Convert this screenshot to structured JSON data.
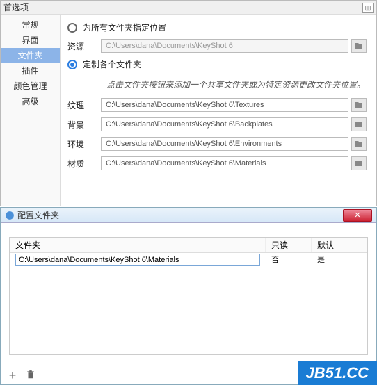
{
  "topWindow": {
    "title": "首选项",
    "sidebar": {
      "items": [
        {
          "label": "常规"
        },
        {
          "label": "界面"
        },
        {
          "label": "文件夹"
        },
        {
          "label": "插件"
        },
        {
          "label": "颜色管理"
        },
        {
          "label": "高级"
        }
      ],
      "selectedIndex": 2
    },
    "content": {
      "radio1_label": "为所有文件夹指定位置",
      "resource_label": "资源",
      "resource_path": "C:\\Users\\dana\\Documents\\KeyShot 6",
      "radio2_label": "定制各个文件夹",
      "hint": "点击文件夹按钮来添加一个共享文件夹或为特定资源更改文件夹位置。",
      "rows": [
        {
          "label": "纹理",
          "path": "C:\\Users\\dana\\Documents\\KeyShot 6\\Textures"
        },
        {
          "label": "背景",
          "path": "C:\\Users\\dana\\Documents\\KeyShot 6\\Backplates"
        },
        {
          "label": "环境",
          "path": "C:\\Users\\dana\\Documents\\KeyShot 6\\Environments"
        },
        {
          "label": "材质",
          "path": "C:\\Users\\dana\\Documents\\KeyShot 6\\Materials"
        }
      ]
    }
  },
  "bottomWindow": {
    "title": "配置文件夹",
    "columns": {
      "c1": "文件夹",
      "c2": "只读",
      "c3": "默认"
    },
    "row": {
      "path": "C:\\Users\\dana\\Documents\\KeyShot 6\\Materials",
      "readonly": "否",
      "default": "是"
    }
  },
  "watermark": "JB51.CC"
}
